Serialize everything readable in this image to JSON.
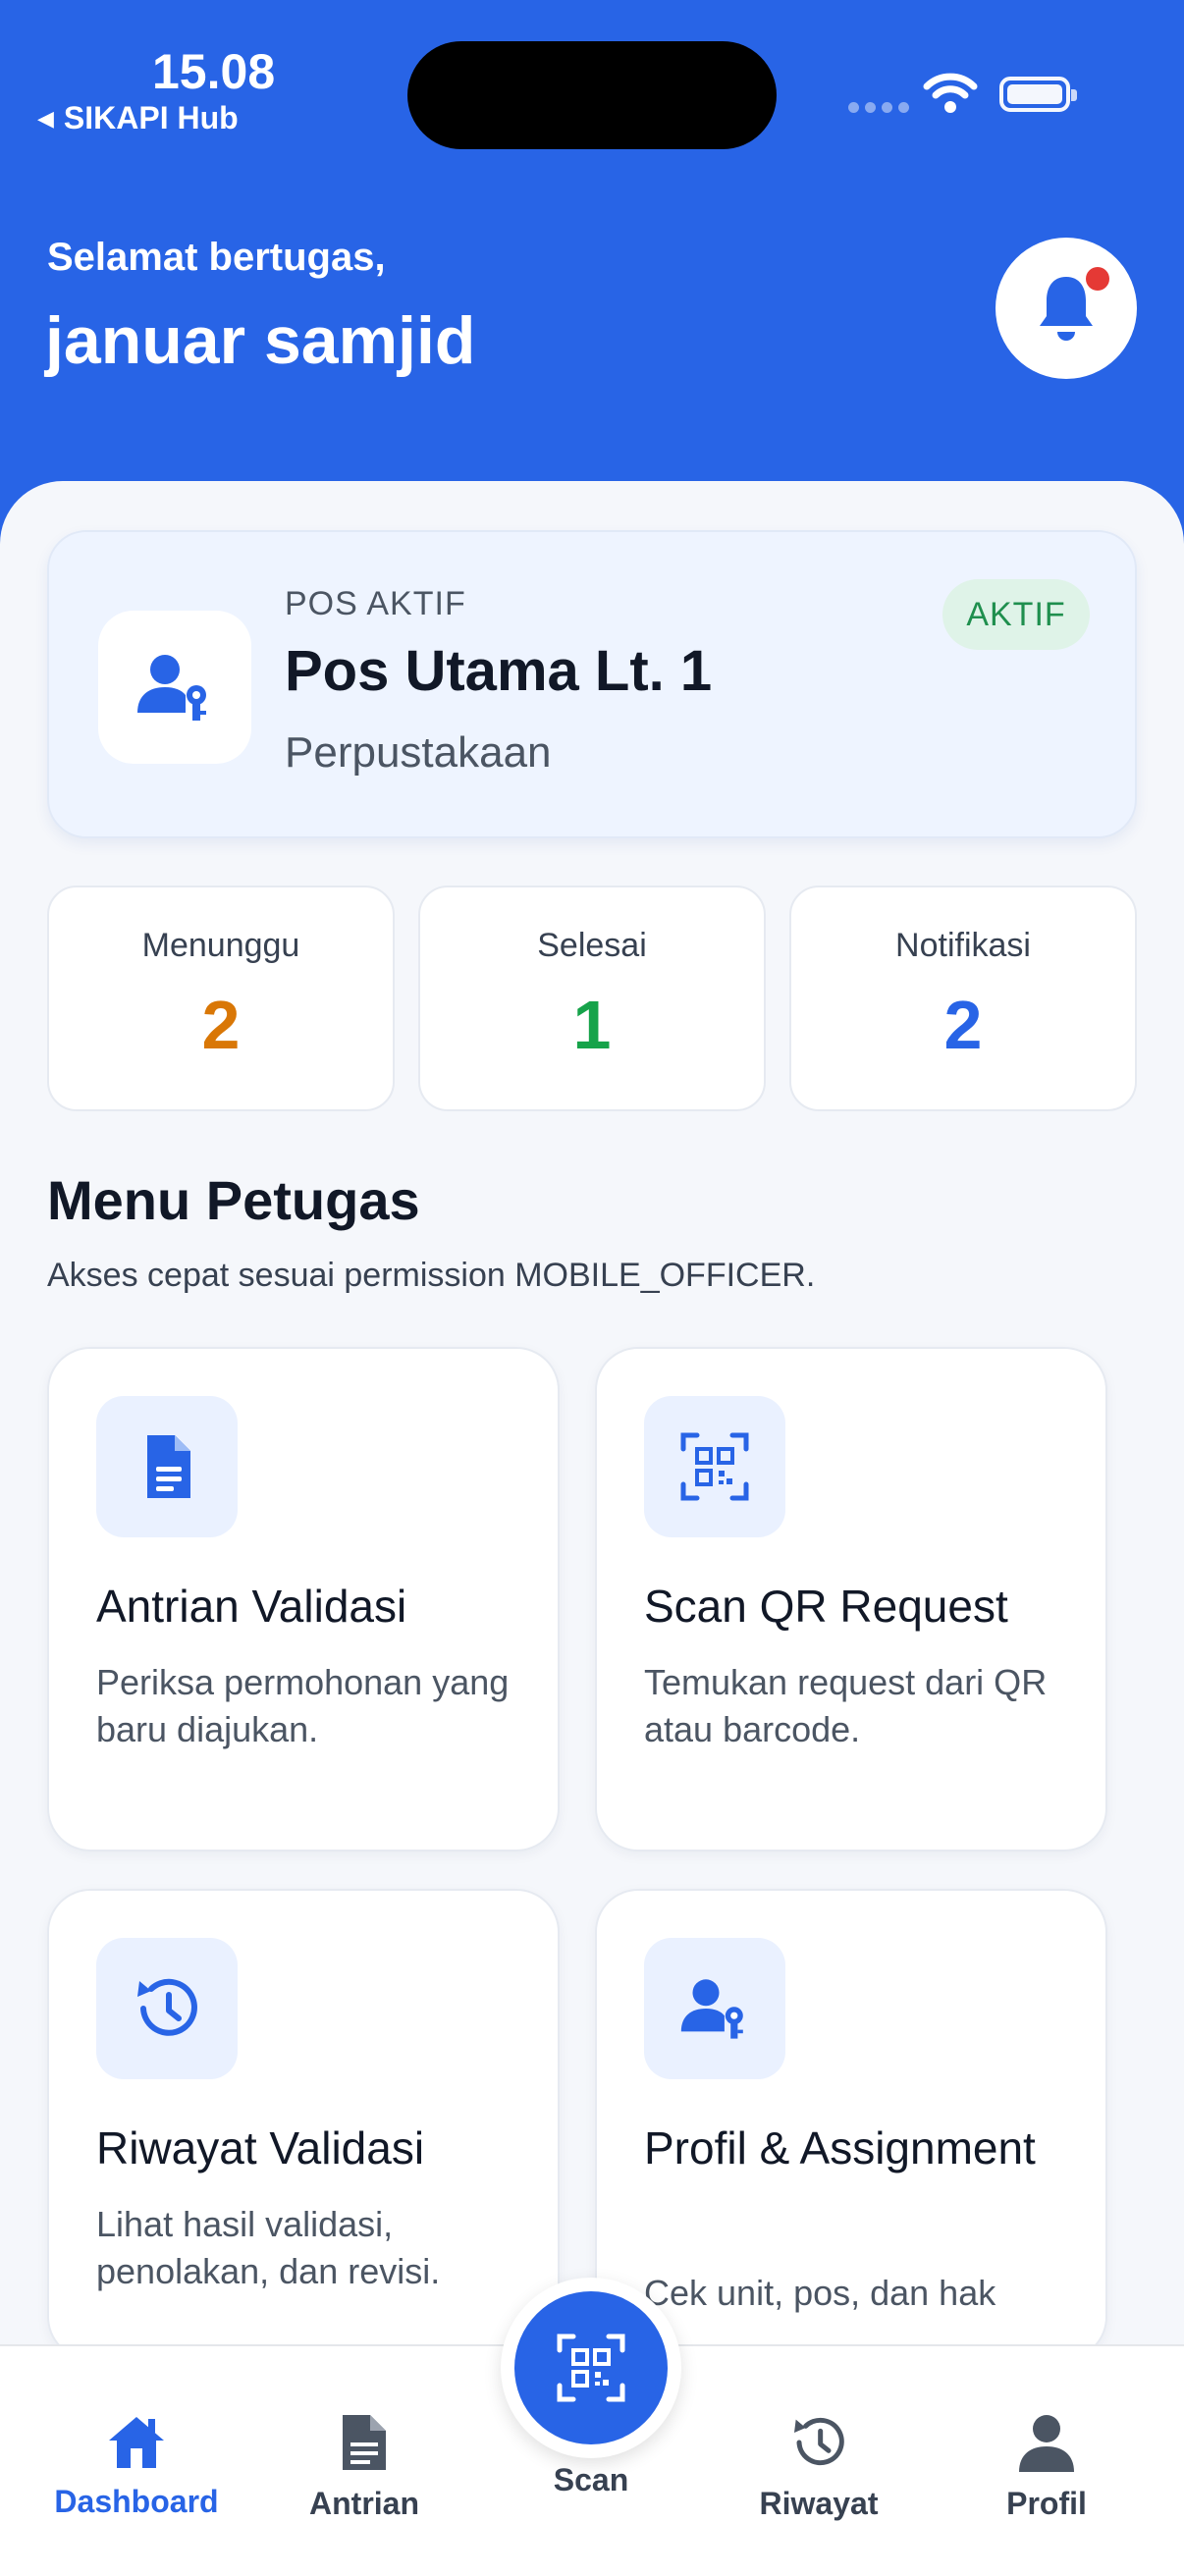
{
  "status_bar": {
    "time": "15.08",
    "back_app": "SIKAPI Hub"
  },
  "header": {
    "greeting": "Selamat bertugas,",
    "username": "januar samjid"
  },
  "pos_card": {
    "label": "POS AKTIF",
    "name": "Pos Utama Lt. 1",
    "place": "Perpustakaan",
    "badge": "AKTIF"
  },
  "stats": [
    {
      "label": "Menunggu",
      "value": "2",
      "color": "#d97706"
    },
    {
      "label": "Selesai",
      "value": "1",
      "color": "#16a34a"
    },
    {
      "label": "Notifikasi",
      "value": "2",
      "color": "#2864e6"
    }
  ],
  "menu": {
    "title": "Menu Petugas",
    "subtitle": "Akses cepat sesuai permission MOBILE_OFFICER.",
    "items": [
      {
        "title": "Antrian Validasi",
        "desc": "Periksa permohonan yang baru diajukan.",
        "icon": "document-icon"
      },
      {
        "title": "Scan QR Request",
        "desc": "Temukan request dari QR atau barcode.",
        "icon": "qr-scan-icon"
      },
      {
        "title": "Riwayat Validasi",
        "desc": "Lihat hasil validasi, penolakan, dan revisi.",
        "icon": "history-icon"
      },
      {
        "title": "Profil & Assignment",
        "desc": "Cek unit, pos, dan hak",
        "icon": "user-key-icon"
      }
    ]
  },
  "nav": {
    "dashboard": "Dashboard",
    "antrian": "Antrian",
    "scan": "Scan",
    "riwayat": "Riwayat",
    "profil": "Profil"
  },
  "colors": {
    "primary": "#2864e6",
    "badge_green": "#1f8f4e",
    "notification_dot": "#e53935"
  }
}
